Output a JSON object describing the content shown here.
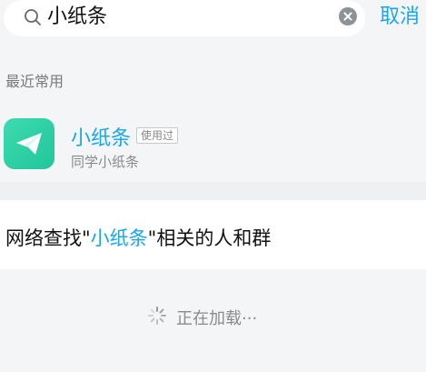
{
  "search": {
    "query": "小纸条",
    "cancel_label": "取消"
  },
  "recent": {
    "title": "最近常用",
    "items": [
      {
        "name": "小纸条",
        "badge": "使用过",
        "subtitle": "同学小纸条",
        "icon": "paper-plane-icon",
        "icon_color": "#2fd0a6"
      }
    ]
  },
  "network": {
    "prefix": "网络查找\"",
    "keyword": "小纸条",
    "suffix": "\"相关的人和群"
  },
  "loading": {
    "text": "正在加载···"
  },
  "colors": {
    "accent": "#18a7e8",
    "background": "#f4f5f7"
  }
}
